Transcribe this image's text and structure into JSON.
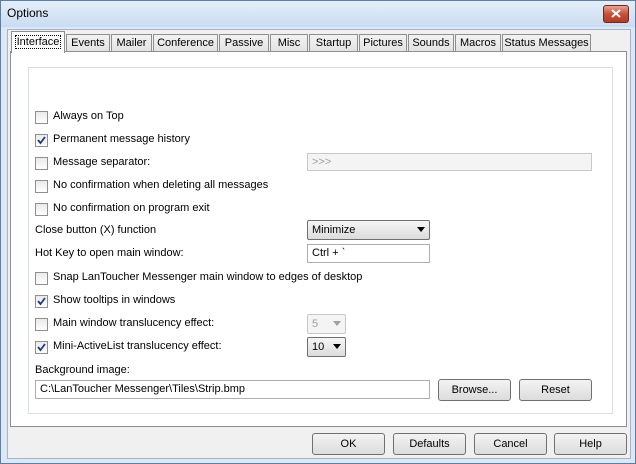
{
  "window": {
    "title": "Options"
  },
  "tabs": [
    "Interface",
    "Events",
    "Mailer",
    "Conference",
    "Passive",
    "Misc",
    "Startup",
    "Pictures",
    "Sounds",
    "Macros",
    "Status Messages"
  ],
  "options": {
    "always_on_top": {
      "label": "Always on Top",
      "checked": false
    },
    "permanent_history": {
      "label": "Permanent message history",
      "checked": true
    },
    "message_separator": {
      "label": "Message separator:",
      "checked": false,
      "value": ">>>"
    },
    "no_confirm_delete": {
      "label": "No confirmation when deleting all messages",
      "checked": false
    },
    "no_confirm_exit": {
      "label": "No confirmation on program exit",
      "checked": false
    },
    "close_button": {
      "label": "Close button (X) function",
      "value": "Minimize"
    },
    "hotkey": {
      "label": "Hot Key to open main window:",
      "value": "Ctrl + `"
    },
    "snap": {
      "label": "Snap LanToucher Messenger main window to edges of desktop",
      "checked": false
    },
    "tooltips": {
      "label": "Show tooltips in windows",
      "checked": true
    },
    "main_translucency": {
      "label": "Main window translucency effect:",
      "checked": false,
      "value": "5"
    },
    "mini_translucency": {
      "label": "Mini-ActiveList translucency effect:",
      "checked": true,
      "value": "10"
    },
    "background": {
      "label": "Background image:",
      "value": "C:\\LanToucher Messenger\\Tiles\\Strip.bmp",
      "browse": "Browse...",
      "reset": "Reset"
    }
  },
  "buttons": {
    "ok": "OK",
    "defaults": "Defaults",
    "cancel": "Cancel",
    "help": "Help"
  }
}
